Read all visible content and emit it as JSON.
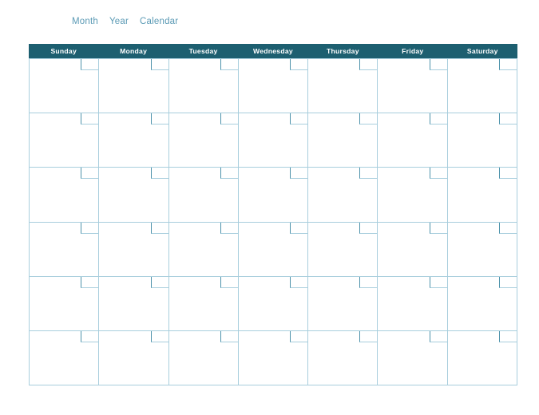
{
  "title": {
    "words": [
      "Month",
      "Year",
      "Calendar"
    ],
    "full_text": "Month Year Calendar",
    "color": "#5b9ab5"
  },
  "calendar": {
    "weekday_headers": [
      "Sunday",
      "Monday",
      "Tuesday",
      "Wednesday",
      "Thursday",
      "Friday",
      "Saturday"
    ],
    "week_count": 6,
    "days_per_week": 7,
    "weeks": [
      [
        "",
        "",
        "",
        "",
        "",
        "",
        ""
      ],
      [
        "",
        "",
        "",
        "",
        "",
        "",
        ""
      ],
      [
        "",
        "",
        "",
        "",
        "",
        "",
        ""
      ],
      [
        "",
        "",
        "",
        "",
        "",
        "",
        ""
      ],
      [
        "",
        "",
        "",
        "",
        "",
        "",
        ""
      ],
      [
        "",
        "",
        "",
        "",
        "",
        "",
        ""
      ]
    ],
    "colors": {
      "header_background": "#1d5f70",
      "header_text": "#ffffff",
      "grid_line": "#a8cedd",
      "date_box_accent": "#4e93ab",
      "cell_background": "#ffffff",
      "page_background": "#ffffff"
    }
  }
}
